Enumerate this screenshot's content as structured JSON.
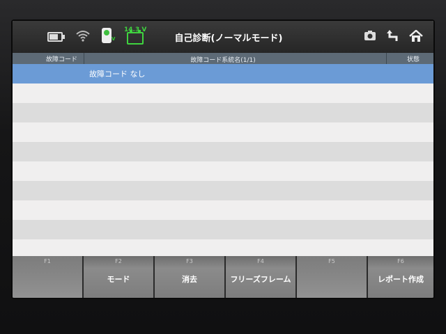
{
  "status": {
    "voltage": "14.3 V",
    "vci_label": "V"
  },
  "header": {
    "title": "自己診断(ノーマルモード)"
  },
  "icons": {
    "battery": "battery-icon",
    "wifi": "wifi-icon",
    "vci": "vci-icon",
    "car_battery": "car-battery-icon",
    "camera": "camera-icon",
    "back": "back-arrow-icon",
    "home": "home-icon"
  },
  "table": {
    "columns": {
      "code": "故障コード",
      "system": "故障コード系統名(1/1)",
      "state": "状態"
    },
    "rows": [
      {
        "code": "",
        "name": "故障コード なし",
        "state": "",
        "selected": true
      }
    ]
  },
  "function_keys": [
    {
      "num": "F1",
      "label": ""
    },
    {
      "num": "F2",
      "label": "モード"
    },
    {
      "num": "F3",
      "label": "消去"
    },
    {
      "num": "F4",
      "label": "フリーズフレーム"
    },
    {
      "num": "F5",
      "label": ""
    },
    {
      "num": "F6",
      "label": "レポート作成"
    }
  ],
  "colors": {
    "accent_green": "#3fd43f",
    "selection_blue": "#6b9bd6",
    "header_bg": "#5d6a76"
  }
}
